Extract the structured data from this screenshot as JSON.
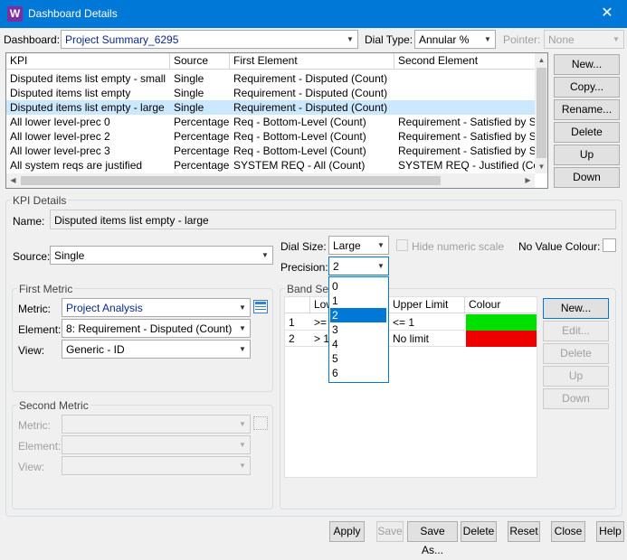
{
  "window": {
    "title": "Dashboard Details",
    "icon_letter": "W"
  },
  "top": {
    "dashboard_label": "Dashboard:",
    "dashboard_value": "Project Summary_6295",
    "dial_type_label": "Dial Type:",
    "dial_type_value": "Annular %",
    "pointer_label": "Pointer:",
    "pointer_value": "None"
  },
  "kpi_table": {
    "columns": [
      "KPI",
      "Source",
      "First Element",
      "Second Element"
    ],
    "rows": [
      {
        "kpi": "Disputed items list empty - small",
        "source": "Single",
        "first": "Requirement - Disputed (Count)",
        "second": ""
      },
      {
        "kpi": "Disputed items list empty",
        "source": "Single",
        "first": "Requirement - Disputed (Count)",
        "second": ""
      },
      {
        "kpi": "Disputed items list empty - large",
        "source": "Single",
        "first": "Requirement - Disputed (Count)",
        "second": ""
      },
      {
        "kpi": "All lower level-prec 0",
        "source": "Percentage",
        "first": "Req - Bottom-Level (Count)",
        "second": "Requirement - Satisfied by SY"
      },
      {
        "kpi": "All lower level-prec 2",
        "source": "Percentage",
        "first": "Req - Bottom-Level (Count)",
        "second": "Requirement - Satisfied by SY"
      },
      {
        "kpi": "All lower level-prec 3",
        "source": "Percentage",
        "first": "Req - Bottom-Level (Count)",
        "second": "Requirement - Satisfied by SY"
      },
      {
        "kpi": "All system reqs are justified",
        "source": "Percentage",
        "first": "SYSTEM REQ - All (Count)",
        "second": "SYSTEM REQ - Justified (Cour"
      }
    ],
    "selected_index": 2
  },
  "right_buttons": [
    "New...",
    "Copy...",
    "Rename...",
    "Delete",
    "Up",
    "Down"
  ],
  "details": {
    "group_title": "KPI Details",
    "name_label": "Name:",
    "name_value": "Disputed items list empty - large",
    "source_label": "Source:",
    "source_value": "Single",
    "dial_size_label": "Dial Size:",
    "dial_size_value": "Large",
    "hide_numeric_label": "Hide numeric scale",
    "no_value_colour_label": "No Value Colour:",
    "precision_label": "Precision:",
    "precision_value": "2",
    "precision_options": [
      "0",
      "1",
      "2",
      "3",
      "4",
      "5",
      "6"
    ],
    "precision_selected": "2"
  },
  "first_metric": {
    "title": "First Metric",
    "metric_label": "Metric:",
    "metric_value": "Project Analysis",
    "element_label": "Element:",
    "element_value": "8: Requirement - Disputed (Count)",
    "view_label": "View:",
    "view_value": "Generic - ID"
  },
  "second_metric": {
    "title": "Second Metric",
    "metric_label": "Metric:",
    "element_label": "Element:",
    "view_label": "View:"
  },
  "bands": {
    "title": "Band Set",
    "columns": [
      "Low",
      "Upper Limit",
      "Colour"
    ],
    "rows": [
      {
        "num": "1",
        "lower": ">=",
        "upper": "<= 1",
        "color": "#00e000"
      },
      {
        "num": "2",
        "lower": "> 1",
        "upper": "No limit",
        "color": "#ee0000"
      }
    ],
    "buttons": [
      "New...",
      "Edit...",
      "Delete",
      "Up",
      "Down"
    ]
  },
  "bottom_buttons": [
    "Apply",
    "Save",
    "Save As...",
    "Delete",
    "Reset",
    "Close",
    "Help"
  ],
  "colors": {
    "titlebar": "#0078d7",
    "selection": "#cce8ff",
    "accent": "#0078d7"
  }
}
